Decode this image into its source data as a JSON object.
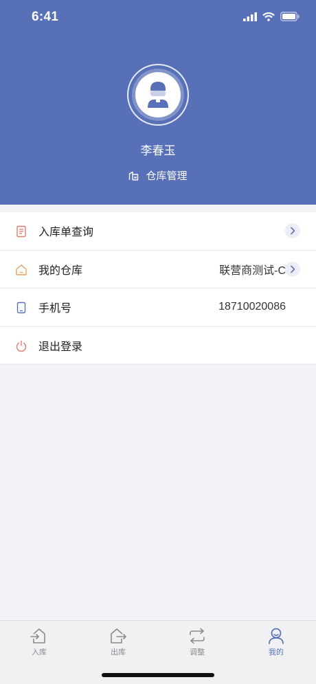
{
  "status_bar": {
    "time": "6:41"
  },
  "profile": {
    "name": "李春玉",
    "role": "仓库管理"
  },
  "menu": [
    {
      "label": "入库单查询",
      "value": "",
      "has_arrow": true,
      "icon": "document-icon",
      "icon_color": "#e07a6e"
    },
    {
      "label": "我的仓库",
      "value": "联营商测试-C",
      "has_arrow": true,
      "icon": "house-icon",
      "icon_color": "#e8a060"
    },
    {
      "label": "手机号",
      "value": "18710020086",
      "has_arrow": false,
      "icon": "phone-icon",
      "icon_color": "#5770b8"
    },
    {
      "label": "退出登录",
      "value": "",
      "has_arrow": false,
      "icon": "power-icon",
      "icon_color": "#e07a6e"
    }
  ],
  "tabs": [
    {
      "label": "入库",
      "icon": "inbound-icon",
      "active": false
    },
    {
      "label": "出库",
      "icon": "outbound-icon",
      "active": false
    },
    {
      "label": "调整",
      "icon": "adjust-icon",
      "active": false
    },
    {
      "label": "我的",
      "icon": "user-icon",
      "active": true
    }
  ],
  "colors": {
    "primary": "#5770b8",
    "background": "#f2f3f7"
  }
}
